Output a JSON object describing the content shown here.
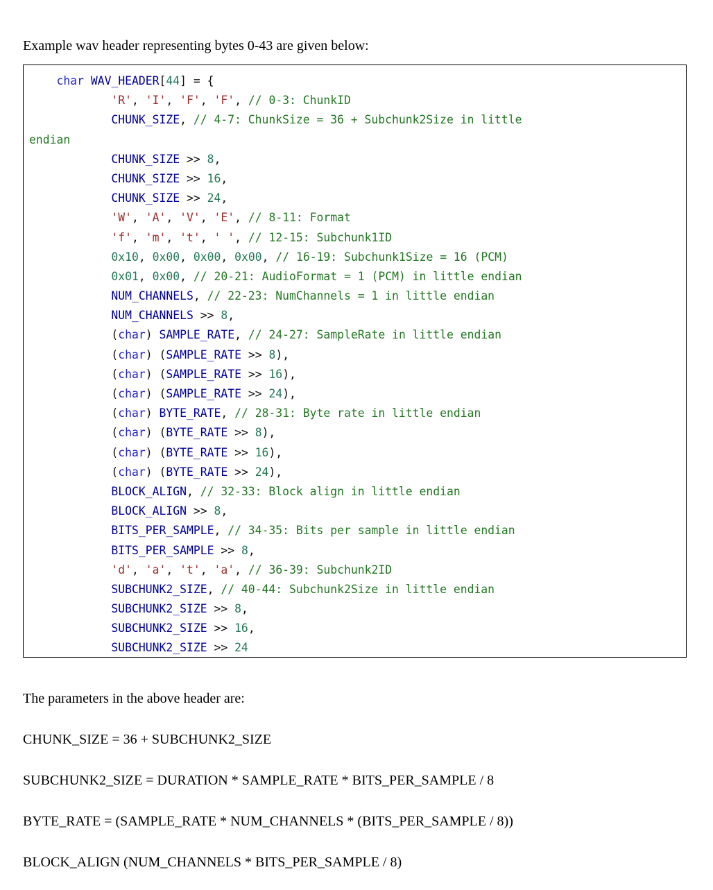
{
  "document": {
    "intro_text": "Example wav header representing bytes 0-43 are given below:",
    "params_heading": "The parameters in the above header are:"
  },
  "colors": {
    "keyword": "#2222cc",
    "identifier": "#000099",
    "number": "#227755",
    "string": "#a02c2c",
    "comment": "#227722",
    "punctuation": "#101010",
    "border": "#000000",
    "background": "#ffffff",
    "text": "#000000"
  },
  "code_block": {
    "language": "c",
    "lines": [
      [
        {
          "t": "pun",
          "v": "    "
        },
        {
          "t": "kw",
          "v": "char"
        },
        {
          "t": "pun",
          "v": " "
        },
        {
          "t": "id",
          "v": "WAV_HEADER"
        },
        {
          "t": "pun",
          "v": "["
        },
        {
          "t": "num",
          "v": "44"
        },
        {
          "t": "pun",
          "v": "] = {"
        }
      ],
      [
        {
          "t": "pun",
          "v": "            "
        },
        {
          "t": "str",
          "v": "'R'"
        },
        {
          "t": "pun",
          "v": ", "
        },
        {
          "t": "str",
          "v": "'I'"
        },
        {
          "t": "pun",
          "v": ", "
        },
        {
          "t": "str",
          "v": "'F'"
        },
        {
          "t": "pun",
          "v": ", "
        },
        {
          "t": "str",
          "v": "'F'"
        },
        {
          "t": "pun",
          "v": ", "
        },
        {
          "t": "com",
          "v": "// 0-3: ChunkID"
        }
      ],
      [
        {
          "t": "pun",
          "v": "            "
        },
        {
          "t": "id",
          "v": "CHUNK_SIZE"
        },
        {
          "t": "pun",
          "v": ", "
        },
        {
          "t": "com",
          "v": "// 4-7: ChunkSize = 36 + Subchunk2Size in little"
        }
      ],
      [
        {
          "t": "com",
          "v": "endian"
        }
      ],
      [
        {
          "t": "pun",
          "v": "            "
        },
        {
          "t": "id",
          "v": "CHUNK_SIZE"
        },
        {
          "t": "pun",
          "v": " >> "
        },
        {
          "t": "num",
          "v": "8"
        },
        {
          "t": "pun",
          "v": ","
        }
      ],
      [
        {
          "t": "pun",
          "v": "            "
        },
        {
          "t": "id",
          "v": "CHUNK_SIZE"
        },
        {
          "t": "pun",
          "v": " >> "
        },
        {
          "t": "num",
          "v": "16"
        },
        {
          "t": "pun",
          "v": ","
        }
      ],
      [
        {
          "t": "pun",
          "v": "            "
        },
        {
          "t": "id",
          "v": "CHUNK_SIZE"
        },
        {
          "t": "pun",
          "v": " >> "
        },
        {
          "t": "num",
          "v": "24"
        },
        {
          "t": "pun",
          "v": ","
        }
      ],
      [
        {
          "t": "pun",
          "v": "            "
        },
        {
          "t": "str",
          "v": "'W'"
        },
        {
          "t": "pun",
          "v": ", "
        },
        {
          "t": "str",
          "v": "'A'"
        },
        {
          "t": "pun",
          "v": ", "
        },
        {
          "t": "str",
          "v": "'V'"
        },
        {
          "t": "pun",
          "v": ", "
        },
        {
          "t": "str",
          "v": "'E'"
        },
        {
          "t": "pun",
          "v": ", "
        },
        {
          "t": "com",
          "v": "// 8-11: Format"
        }
      ],
      [
        {
          "t": "pun",
          "v": "            "
        },
        {
          "t": "str",
          "v": "'f'"
        },
        {
          "t": "pun",
          "v": ", "
        },
        {
          "t": "str",
          "v": "'m'"
        },
        {
          "t": "pun",
          "v": ", "
        },
        {
          "t": "str",
          "v": "'t'"
        },
        {
          "t": "pun",
          "v": ", "
        },
        {
          "t": "str",
          "v": "' '"
        },
        {
          "t": "pun",
          "v": ", "
        },
        {
          "t": "com",
          "v": "// 12-15: Subchunk1ID"
        }
      ],
      [
        {
          "t": "pun",
          "v": "            "
        },
        {
          "t": "num",
          "v": "0x10"
        },
        {
          "t": "pun",
          "v": ", "
        },
        {
          "t": "num",
          "v": "0x00"
        },
        {
          "t": "pun",
          "v": ", "
        },
        {
          "t": "num",
          "v": "0x00"
        },
        {
          "t": "pun",
          "v": ", "
        },
        {
          "t": "num",
          "v": "0x00"
        },
        {
          "t": "pun",
          "v": ", "
        },
        {
          "t": "com",
          "v": "// 16-19: Subchunk1Size = 16 (PCM)"
        }
      ],
      [
        {
          "t": "pun",
          "v": "            "
        },
        {
          "t": "num",
          "v": "0x01"
        },
        {
          "t": "pun",
          "v": ", "
        },
        {
          "t": "num",
          "v": "0x00"
        },
        {
          "t": "pun",
          "v": ", "
        },
        {
          "t": "com",
          "v": "// 20-21: AudioFormat = 1 (PCM) in little endian"
        }
      ],
      [
        {
          "t": "pun",
          "v": "            "
        },
        {
          "t": "id",
          "v": "NUM_CHANNELS"
        },
        {
          "t": "pun",
          "v": ", "
        },
        {
          "t": "com",
          "v": "// 22-23: NumChannels = 1 in little endian"
        }
      ],
      [
        {
          "t": "pun",
          "v": "            "
        },
        {
          "t": "id",
          "v": "NUM_CHANNELS"
        },
        {
          "t": "pun",
          "v": " >> "
        },
        {
          "t": "num",
          "v": "8"
        },
        {
          "t": "pun",
          "v": ","
        }
      ],
      [
        {
          "t": "pun",
          "v": "            ("
        },
        {
          "t": "kw",
          "v": "char"
        },
        {
          "t": "pun",
          "v": ") "
        },
        {
          "t": "id",
          "v": "SAMPLE_RATE"
        },
        {
          "t": "pun",
          "v": ", "
        },
        {
          "t": "com",
          "v": "// 24-27: SampleRate in little endian"
        }
      ],
      [
        {
          "t": "pun",
          "v": "            ("
        },
        {
          "t": "kw",
          "v": "char"
        },
        {
          "t": "pun",
          "v": ") ("
        },
        {
          "t": "id",
          "v": "SAMPLE_RATE"
        },
        {
          "t": "pun",
          "v": " >> "
        },
        {
          "t": "num",
          "v": "8"
        },
        {
          "t": "pun",
          "v": "),"
        }
      ],
      [
        {
          "t": "pun",
          "v": "            ("
        },
        {
          "t": "kw",
          "v": "char"
        },
        {
          "t": "pun",
          "v": ") ("
        },
        {
          "t": "id",
          "v": "SAMPLE_RATE"
        },
        {
          "t": "pun",
          "v": " >> "
        },
        {
          "t": "num",
          "v": "16"
        },
        {
          "t": "pun",
          "v": "),"
        }
      ],
      [
        {
          "t": "pun",
          "v": "            ("
        },
        {
          "t": "kw",
          "v": "char"
        },
        {
          "t": "pun",
          "v": ") ("
        },
        {
          "t": "id",
          "v": "SAMPLE_RATE"
        },
        {
          "t": "pun",
          "v": " >> "
        },
        {
          "t": "num",
          "v": "24"
        },
        {
          "t": "pun",
          "v": "),"
        }
      ],
      [
        {
          "t": "pun",
          "v": "            ("
        },
        {
          "t": "kw",
          "v": "char"
        },
        {
          "t": "pun",
          "v": ") "
        },
        {
          "t": "id",
          "v": "BYTE_RATE"
        },
        {
          "t": "pun",
          "v": ", "
        },
        {
          "t": "com",
          "v": "// 28-31: Byte rate in little endian"
        }
      ],
      [
        {
          "t": "pun",
          "v": "            ("
        },
        {
          "t": "kw",
          "v": "char"
        },
        {
          "t": "pun",
          "v": ") ("
        },
        {
          "t": "id",
          "v": "BYTE_RATE"
        },
        {
          "t": "pun",
          "v": " >> "
        },
        {
          "t": "num",
          "v": "8"
        },
        {
          "t": "pun",
          "v": "),"
        }
      ],
      [
        {
          "t": "pun",
          "v": "            ("
        },
        {
          "t": "kw",
          "v": "char"
        },
        {
          "t": "pun",
          "v": ") ("
        },
        {
          "t": "id",
          "v": "BYTE_RATE"
        },
        {
          "t": "pun",
          "v": " >> "
        },
        {
          "t": "num",
          "v": "16"
        },
        {
          "t": "pun",
          "v": "),"
        }
      ],
      [
        {
          "t": "pun",
          "v": "            ("
        },
        {
          "t": "kw",
          "v": "char"
        },
        {
          "t": "pun",
          "v": ") ("
        },
        {
          "t": "id",
          "v": "BYTE_RATE"
        },
        {
          "t": "pun",
          "v": " >> "
        },
        {
          "t": "num",
          "v": "24"
        },
        {
          "t": "pun",
          "v": "),"
        }
      ],
      [
        {
          "t": "pun",
          "v": "            "
        },
        {
          "t": "id",
          "v": "BLOCK_ALIGN"
        },
        {
          "t": "pun",
          "v": ", "
        },
        {
          "t": "com",
          "v": "// 32-33: Block align in little endian"
        }
      ],
      [
        {
          "t": "pun",
          "v": "            "
        },
        {
          "t": "id",
          "v": "BLOCK_ALIGN"
        },
        {
          "t": "pun",
          "v": " >> "
        },
        {
          "t": "num",
          "v": "8"
        },
        {
          "t": "pun",
          "v": ","
        }
      ],
      [
        {
          "t": "pun",
          "v": "            "
        },
        {
          "t": "id",
          "v": "BITS_PER_SAMPLE"
        },
        {
          "t": "pun",
          "v": ", "
        },
        {
          "t": "com",
          "v": "// 34-35: Bits per sample in little endian"
        }
      ],
      [
        {
          "t": "pun",
          "v": "            "
        },
        {
          "t": "id",
          "v": "BITS_PER_SAMPLE"
        },
        {
          "t": "pun",
          "v": " >> "
        },
        {
          "t": "num",
          "v": "8"
        },
        {
          "t": "pun",
          "v": ","
        }
      ],
      [
        {
          "t": "pun",
          "v": "            "
        },
        {
          "t": "str",
          "v": "'d'"
        },
        {
          "t": "pun",
          "v": ", "
        },
        {
          "t": "str",
          "v": "'a'"
        },
        {
          "t": "pun",
          "v": ", "
        },
        {
          "t": "str",
          "v": "'t'"
        },
        {
          "t": "pun",
          "v": ", "
        },
        {
          "t": "str",
          "v": "'a'"
        },
        {
          "t": "pun",
          "v": ", "
        },
        {
          "t": "com",
          "v": "// 36-39: Subchunk2ID"
        }
      ],
      [
        {
          "t": "pun",
          "v": "            "
        },
        {
          "t": "id",
          "v": "SUBCHUNK2_SIZE"
        },
        {
          "t": "pun",
          "v": ", "
        },
        {
          "t": "com",
          "v": "// 40-44: Subchunk2Size in little endian"
        }
      ],
      [
        {
          "t": "pun",
          "v": "            "
        },
        {
          "t": "id",
          "v": "SUBCHUNK2_SIZE"
        },
        {
          "t": "pun",
          "v": " >> "
        },
        {
          "t": "num",
          "v": "8"
        },
        {
          "t": "pun",
          "v": ","
        }
      ],
      [
        {
          "t": "pun",
          "v": "            "
        },
        {
          "t": "id",
          "v": "SUBCHUNK2_SIZE"
        },
        {
          "t": "pun",
          "v": " >> "
        },
        {
          "t": "num",
          "v": "16"
        },
        {
          "t": "pun",
          "v": ","
        }
      ],
      [
        {
          "t": "pun",
          "v": "            "
        },
        {
          "t": "id",
          "v": "SUBCHUNK2_SIZE"
        },
        {
          "t": "pun",
          "v": " >> "
        },
        {
          "t": "num",
          "v": "24"
        }
      ]
    ]
  },
  "parameters": [
    "CHUNK_SIZE = 36 + SUBCHUNK2_SIZE",
    "SUBCHUNK2_SIZE = DURATION * SAMPLE_RATE * BITS_PER_SAMPLE / 8",
    "BYTE_RATE = (SAMPLE_RATE * NUM_CHANNELS * (BITS_PER_SAMPLE / 8))",
    "BLOCK_ALIGN (NUM_CHANNELS * BITS_PER_SAMPLE / 8)"
  ]
}
